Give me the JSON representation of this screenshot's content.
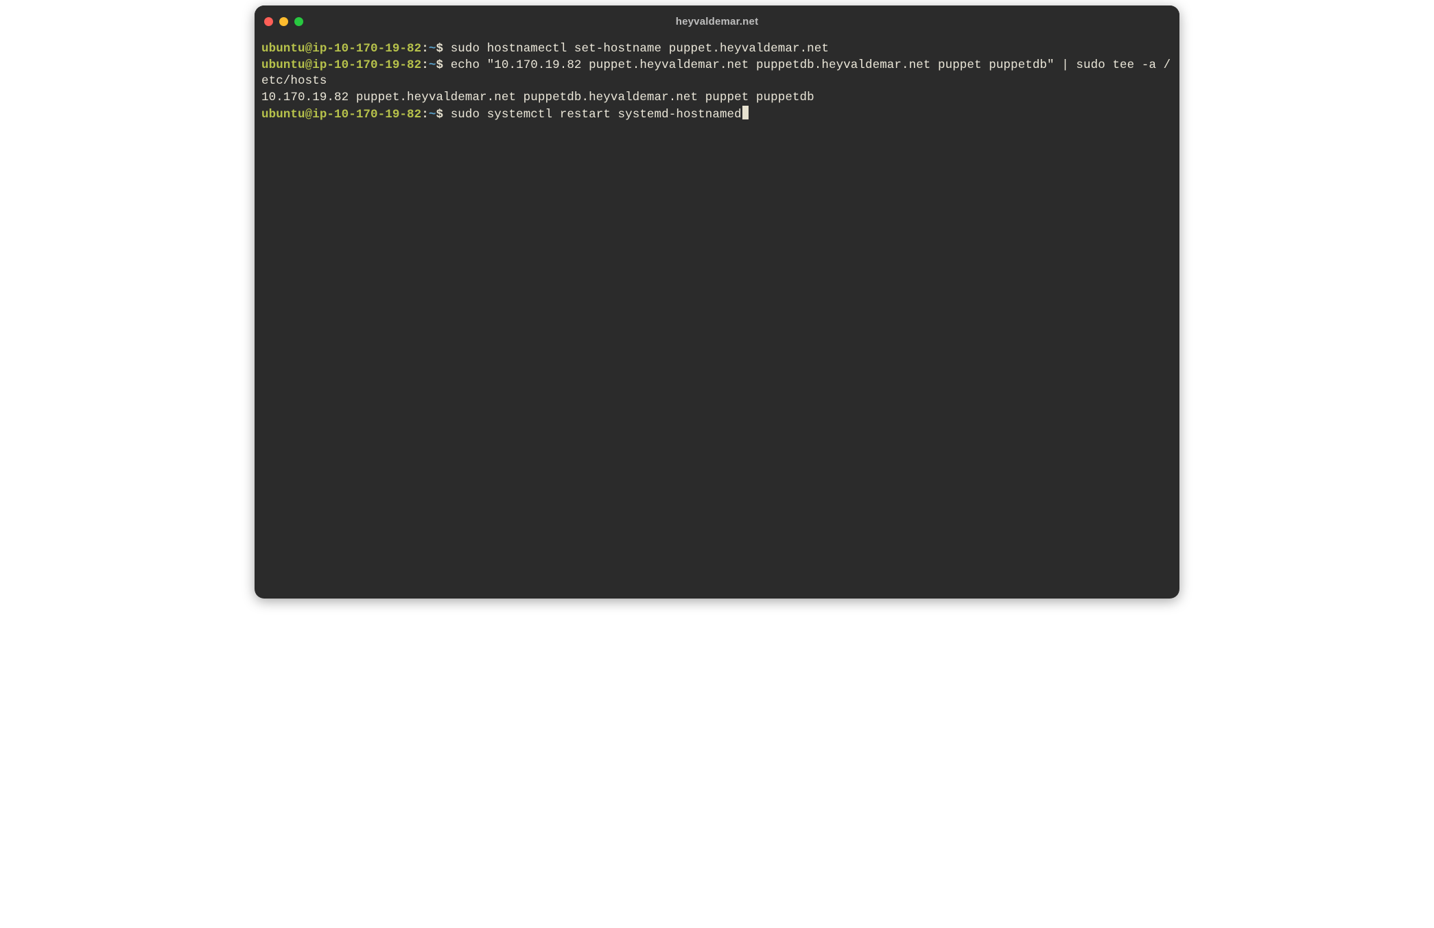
{
  "window": {
    "title": "heyvaldemar.net"
  },
  "prompt": {
    "user_host": "ubuntu@ip-10-170-19-82",
    "colon": ":",
    "path": "~",
    "dollar": "$"
  },
  "lines": [
    {
      "type": "cmd",
      "text": "sudo hostnamectl set-hostname puppet.heyvaldemar.net"
    },
    {
      "type": "cmd",
      "text": "echo \"10.170.19.82 puppet.heyvaldemar.net puppetdb.heyvaldemar.net puppet puppetdb\" | sudo tee -a /etc/hosts"
    },
    {
      "type": "out",
      "text": "10.170.19.82 puppet.heyvaldemar.net puppetdb.heyvaldemar.net puppet puppetdb"
    },
    {
      "type": "cmd",
      "text": "sudo systemctl restart systemd-hostnamed",
      "cursor": true
    }
  ]
}
